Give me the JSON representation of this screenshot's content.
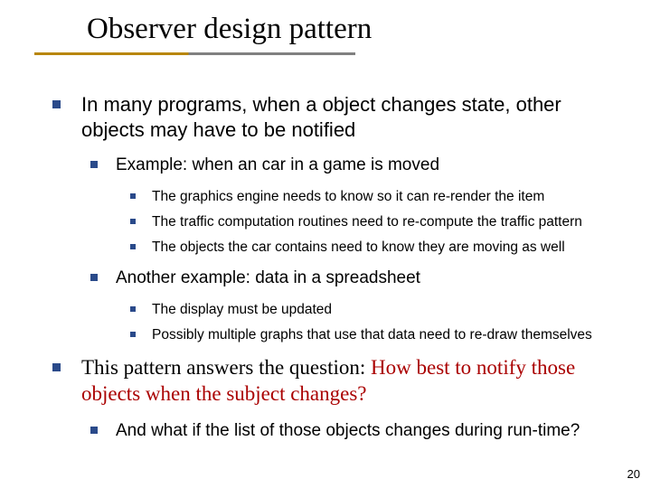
{
  "title": "Observer design pattern",
  "b1": {
    "text": "In many programs, when a object changes state, other objects may have to be notified",
    "sub1": {
      "text": "Example: when an car in a game is moved",
      "items": [
        "The graphics engine needs to know so it can re-render the item",
        "The traffic computation routines need to re-compute the traffic pattern",
        "The objects the car contains need to know they are moving as well"
      ]
    },
    "sub2": {
      "text": "Another example: data in a spreadsheet",
      "items": [
        "The display must be updated",
        "Possibly multiple graphs that use that data need to re-draw themselves"
      ]
    }
  },
  "b2": {
    "prefix": "This pattern answers the question: ",
    "emph": "How best to notify those objects when the subject changes?",
    "sub": "And what if the list of those objects changes during run-time?"
  },
  "pagenum": "20"
}
